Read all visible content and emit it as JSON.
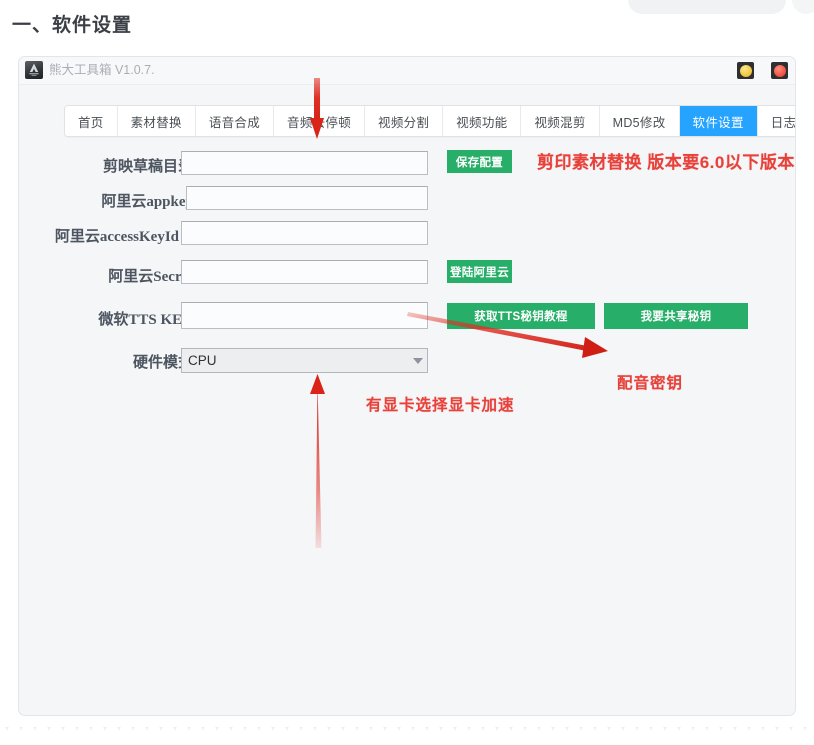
{
  "page": {
    "heading": "一、软件设置"
  },
  "window": {
    "title": "熊大工具箱 V1.0.7.",
    "icon": "app-logo-icon",
    "controls": {
      "minimize": "minimize-button",
      "close": "close-button"
    }
  },
  "tabs": [
    {
      "label": "首页",
      "active": false
    },
    {
      "label": "素材替换",
      "active": false
    },
    {
      "label": "语音合成",
      "active": false
    },
    {
      "label": "音频去停顿",
      "active": false
    },
    {
      "label": "视频分割",
      "active": false
    },
    {
      "label": "视频功能",
      "active": false
    },
    {
      "label": "视频混剪",
      "active": false
    },
    {
      "label": "MD5修改",
      "active": false
    },
    {
      "label": "软件设置",
      "active": true
    },
    {
      "label": "日志",
      "active": false
    }
  ],
  "form": {
    "fields": [
      {
        "label": "剪映草稿目录",
        "value": "",
        "placeholder": "",
        "type": "text"
      },
      {
        "label": "阿里云appkey",
        "value": "",
        "placeholder": "",
        "type": "text"
      },
      {
        "label": "阿里云accessKeyId",
        "value": "",
        "placeholder": "",
        "type": "text"
      },
      {
        "label": "阿里云Secret",
        "value": "",
        "placeholder": "",
        "type": "text"
      },
      {
        "label": "微软TTS KEY",
        "value": "",
        "placeholder": "",
        "type": "text"
      },
      {
        "label": "硬件模式",
        "value": "CPU",
        "placeholder": "",
        "type": "select"
      }
    ]
  },
  "buttons": {
    "save_config": "保存配置",
    "login_aliyun": "登陆阿里云",
    "tts_tutorial": "获取TTS秘钥教程",
    "share_key": "我要共享秘钥"
  },
  "annotations": {
    "version_note": "剪印素材替换 版本要6.0以下版本",
    "gpu_note": "有显卡选择显卡加速",
    "voice_note": "配音密钥"
  },
  "colors": {
    "accent_blue": "#26a2ff",
    "button_green": "#27ae68",
    "annotation_red": "#e8413a",
    "window_bg": "#f4f6f8"
  }
}
